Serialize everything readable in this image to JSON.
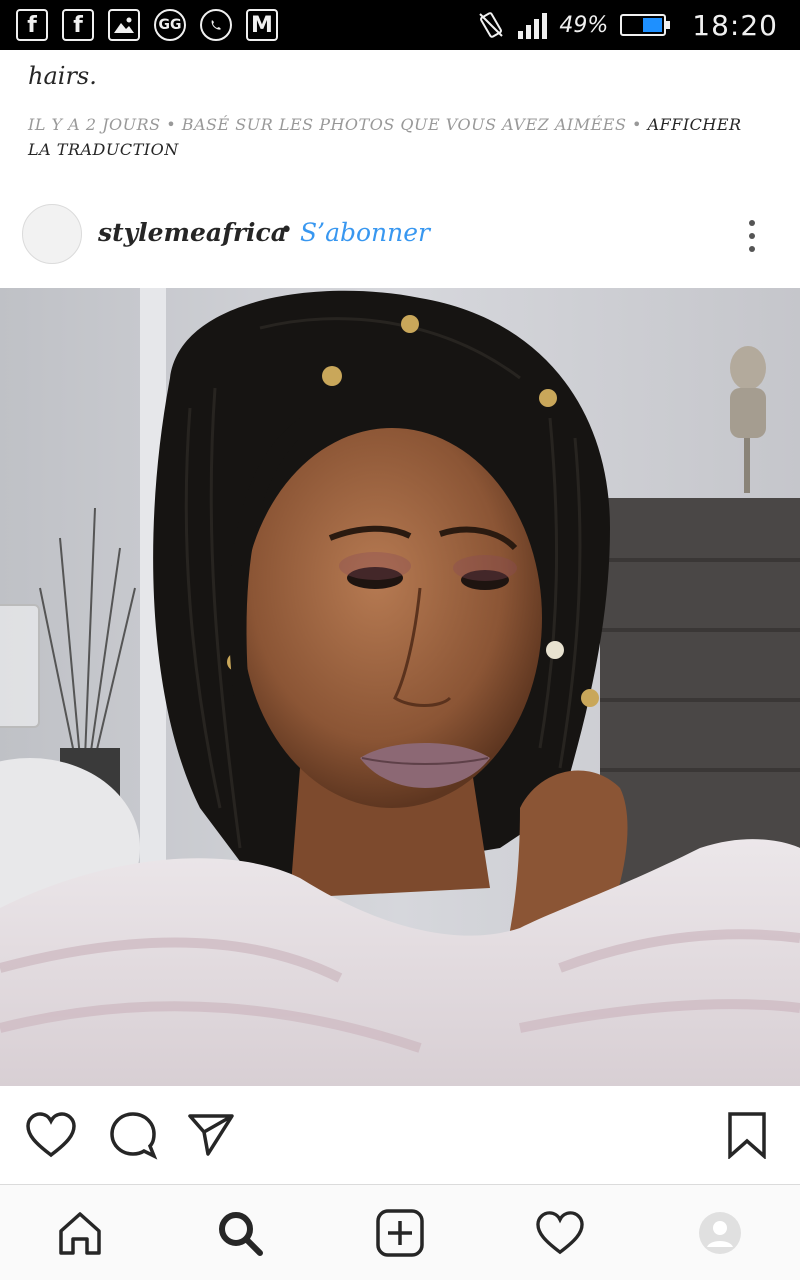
{
  "status_bar": {
    "left_icons": [
      "facebook-icon",
      "facebook-icon",
      "gallery-icon",
      "gossip-icon",
      "whatsapp-icon",
      "gmail-icon"
    ],
    "left_glyphs": [
      "f",
      "f",
      "",
      "GG",
      "",
      "M"
    ],
    "battery_percent": 49,
    "battery_text": "49%",
    "time": "18:20"
  },
  "caption": {
    "last_line": "hairs.",
    "meta_time": "IL Y A 2 JOURS",
    "meta_basis": "BASÉ SUR LES PHOTOS QUE VOUS AVEZ AIMÉES",
    "meta_separator": "•",
    "translate": "AFFICHER LA TRADUCTION"
  },
  "post": {
    "username": "stylemeafrica",
    "separator": "•",
    "follow_label": "S’abonner"
  },
  "colors": {
    "link_blue": "#3897f0",
    "text": "#262626",
    "meta_gray": "#999999",
    "battery_blue": "#1e90ff"
  },
  "actions": [
    "heart-icon",
    "comment-icon",
    "share-icon",
    "bookmark-icon"
  ],
  "nav": [
    "home-icon",
    "search-icon",
    "add-post-icon",
    "activity-icon",
    "profile-icon"
  ]
}
